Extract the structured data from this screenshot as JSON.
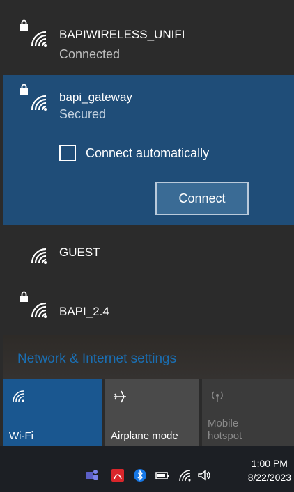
{
  "networks": [
    {
      "ssid": "BAPIWIRELESS_UNIFI",
      "status": "Connected",
      "secured": true
    },
    {
      "ssid": "bapi_gateway",
      "status": "Secured",
      "secured": true
    },
    {
      "ssid": "GUEST",
      "secured": false
    },
    {
      "ssid": "BAPI_2.4",
      "secured": true
    }
  ],
  "selected_network": {
    "connect_automatically_label": "Connect automatically",
    "connect_automatically_checked": false,
    "connect_button": "Connect"
  },
  "settings_link": "Network & Internet settings",
  "quick_actions": [
    {
      "label": "Wi-Fi",
      "icon": "wifi-icon",
      "active": true
    },
    {
      "label": "Airplane mode",
      "icon": "airplane-icon",
      "active": false
    },
    {
      "label": "Mobile hotspot",
      "icon": "hotspot-icon",
      "active": false,
      "disabled": true
    }
  ],
  "taskbar": {
    "time": "1:00 PM",
    "date": "8/22/2023",
    "tray_icons": [
      "teams-icon",
      "pdf-icon",
      "bluetooth-icon",
      "battery-icon",
      "wifi-icon",
      "volume-icon"
    ]
  },
  "colors": {
    "panel_bg": "#2b2b2b",
    "selected_bg": "#1f4d78",
    "accent": "#1a5790",
    "link": "#1a6fb4"
  }
}
